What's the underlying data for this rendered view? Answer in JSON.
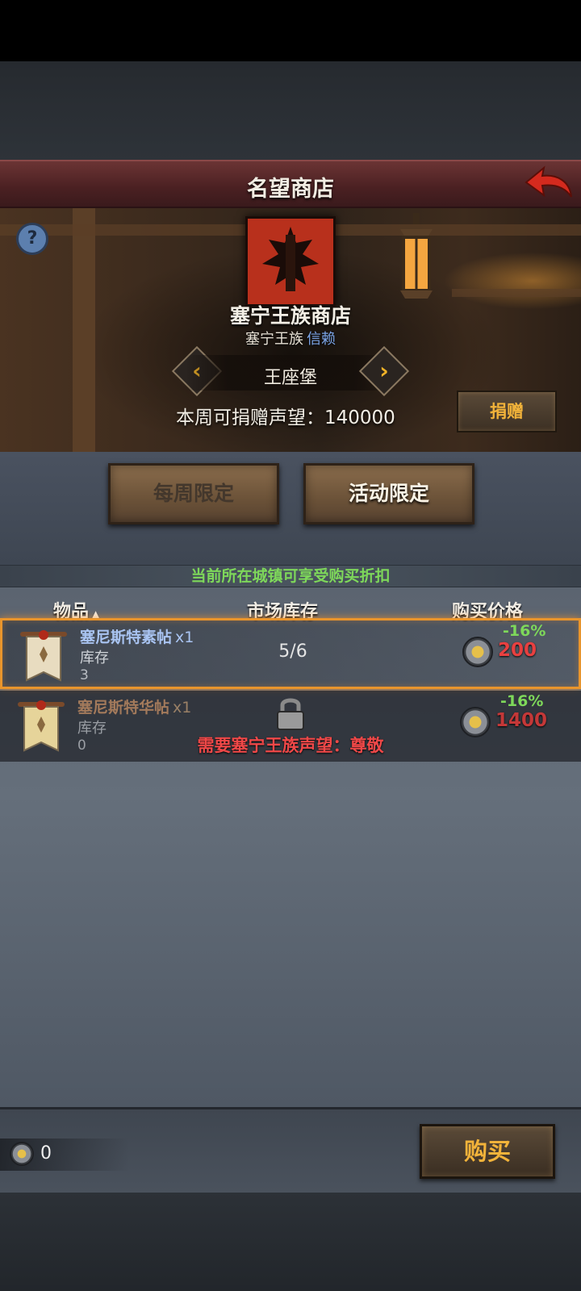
{
  "header": {
    "title": "名望商店"
  },
  "banner": {
    "help": "?",
    "shop_name": "塞宁王族商店",
    "faction": "塞宁王族",
    "trust_level": "信赖",
    "town": "王座堡",
    "prev": "‹",
    "next": "›",
    "weekly_label": "本周可捐赠声望：140000",
    "donate_label": "捐赠"
  },
  "tabs": [
    {
      "label": "每周限定"
    },
    {
      "label": "活动限定"
    }
  ],
  "discount_notice": "当前所在城镇可享受购买折扣",
  "table": {
    "headers": [
      "物品",
      "市场库存",
      "购买价格"
    ],
    "sort_indicator": "▲",
    "items": [
      {
        "name": "塞尼斯特素帖",
        "qty": "x1",
        "stock_label": "库存",
        "stock": "3",
        "market_stock": "5/6",
        "discount": "-16%",
        "price": "200",
        "locked": false
      },
      {
        "name": "塞尼斯特华帖",
        "qty": "x1",
        "stock_label": "库存",
        "stock": "0",
        "discount": "-16%",
        "price": "1400",
        "locked": true,
        "lock_requirement": "需要塞宁王族声望：尊敬"
      }
    ]
  },
  "footer": {
    "currency": "0",
    "buy_label": "购买"
  },
  "colors": {
    "accent_gold": "#f2b33a",
    "discount_green": "#7ed85a",
    "price_red": "#e84040",
    "selection_orange": "#e9952c"
  },
  "icons": [
    "back-arrow-icon",
    "help-icon",
    "faction-crest-icon",
    "chevron-left-icon",
    "chevron-right-icon",
    "sort-up-icon",
    "scroll-banner-icon",
    "coin-icon",
    "lock-icon"
  ]
}
